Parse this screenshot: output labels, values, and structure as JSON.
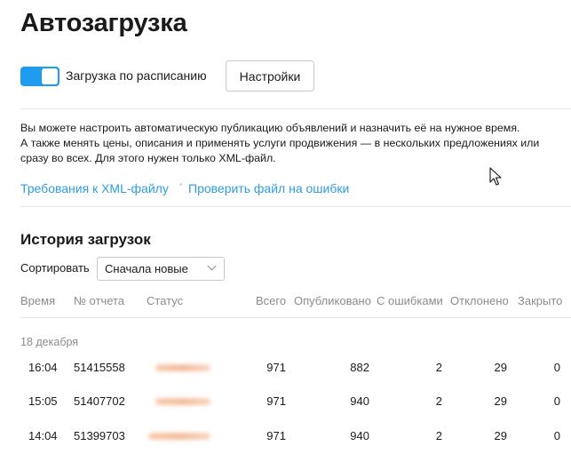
{
  "page": {
    "title": "Автозагрузка"
  },
  "schedule": {
    "label": "Загрузка по расписанию",
    "enabled": true
  },
  "settings_button": {
    "label": "Настройки"
  },
  "description": {
    "line1": "Вы можете настроить автоматическую публикацию объявлений и назначить её на нужное время.",
    "line2": "А также менять цены, описания и применять услуги продвижения — в нескольких предложениях или",
    "line3": "сразу во всех. Для этого нужен только XML-файл."
  },
  "links": {
    "requirements": "Требования к XML-файлу",
    "check": "Проверить файл на ошибки"
  },
  "history": {
    "title": "История загрузок",
    "sort_label": "Сортировать",
    "sort_value": "Сначала новые",
    "columns": {
      "time": "Время",
      "report": "№ отчета",
      "status": "Статус",
      "total": "Всего",
      "published": "Опубликовано",
      "errors": "С ошибками",
      "rejected": "Отклонено",
      "closed": "Закрыто"
    },
    "group_date": "18 декабря",
    "rows": [
      {
        "time": "16:04",
        "report": "51415558",
        "total": "971",
        "published": "882",
        "errors": "2",
        "rejected": "29",
        "closed": "0"
      },
      {
        "time": "15:05",
        "report": "51407702",
        "total": "971",
        "published": "940",
        "errors": "2",
        "rejected": "29",
        "closed": "0"
      },
      {
        "time": "14:04",
        "report": "51399703",
        "total": "971",
        "published": "940",
        "errors": "2",
        "rejected": "29",
        "closed": "0"
      }
    ]
  },
  "colors": {
    "accent": "#1e9cf0",
    "link": "#2f9ce0",
    "muted": "#8c8c8c",
    "status_blur": "#f3b691"
  },
  "icons": {
    "cursor": "mouse-pointer-icon",
    "dropdown": "chevron-down-icon"
  }
}
